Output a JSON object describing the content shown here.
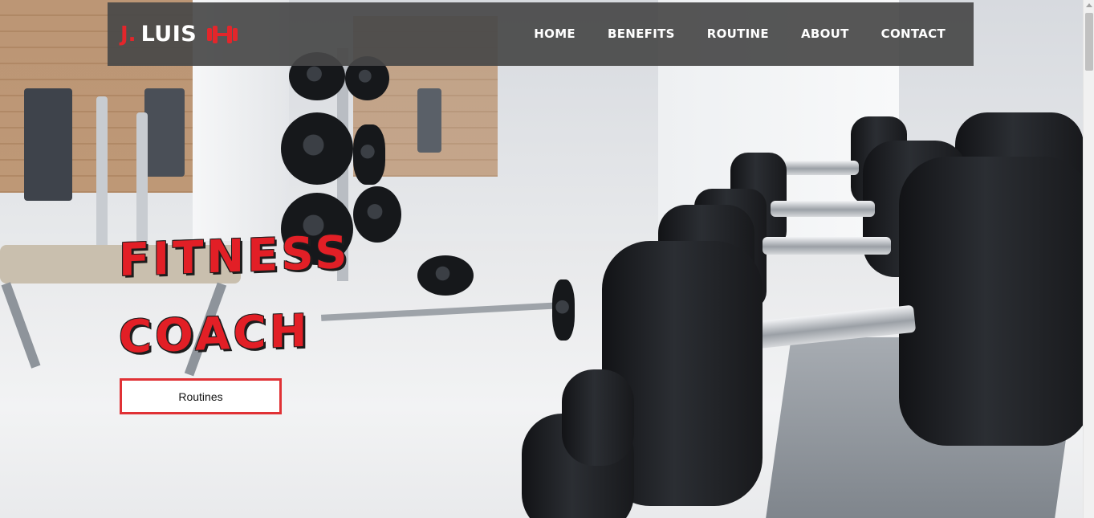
{
  "nav": {
    "brand_initial": "J.",
    "brand_name": "LUIS",
    "brand_icon": "dumbbell-icon",
    "links": [
      {
        "label": "HOME"
      },
      {
        "label": "BENEFITS"
      },
      {
        "label": "ROUTINE"
      },
      {
        "label": "ABOUT"
      },
      {
        "label": "CONTACT"
      }
    ]
  },
  "hero": {
    "title_line1": "FITNESS",
    "title_line2": "COACH",
    "cta_label": "Routines"
  },
  "colors": {
    "accent": "#e3262b",
    "navbar": "#484848",
    "cta_border": "#e03135"
  }
}
